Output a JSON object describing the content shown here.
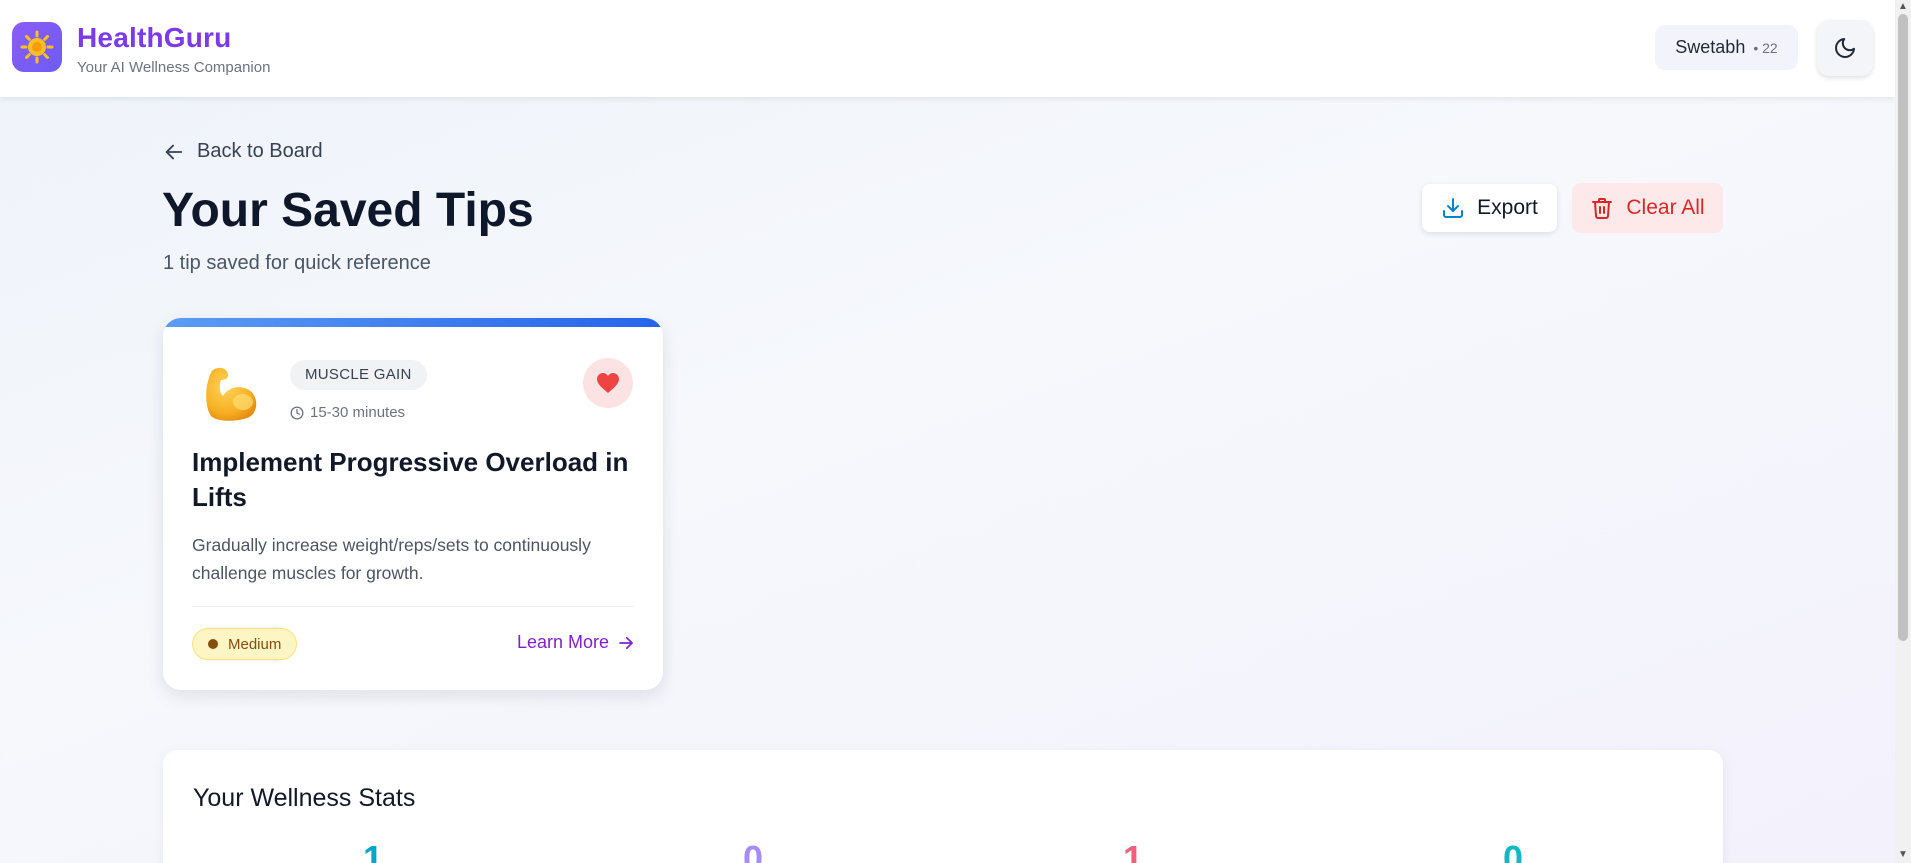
{
  "header": {
    "brand_name": "HealthGuru",
    "brand_tagline": "Your AI Wellness Companion",
    "user_name": "Swetabh",
    "user_age": "• 22",
    "logo_icon": "sun-sparkle-icon",
    "theme_icon": "moon-icon"
  },
  "page": {
    "back_label": "Back to Board",
    "title": "Your Saved Tips",
    "subtitle": "1 tip saved for quick reference",
    "export_label": "Export",
    "clear_label": "Clear All"
  },
  "tip": {
    "emoji": "flexed-biceps-icon",
    "category": "MUSCLE GAIN",
    "duration": "15-30 minutes",
    "title": "Implement Progressive Overload in Lifts",
    "description": "Gradually increase weight/reps/sets to continuously challenge muscles for growth.",
    "difficulty": "Medium",
    "learn_more": "Learn More",
    "favorited": true
  },
  "stats": {
    "title": "Your Wellness Stats",
    "values": [
      {
        "value": "1",
        "color": "#06a4c9"
      },
      {
        "value": "0",
        "color": "#a78bfa"
      },
      {
        "value": "1",
        "color": "#f0607a"
      },
      {
        "value": "0",
        "color": "#14b8c4"
      }
    ]
  },
  "colors": {
    "brand": "#7c3aed",
    "danger": "#dc2626",
    "card_accent": "#2563eb",
    "difficulty_medium": "#fdf5c4"
  }
}
